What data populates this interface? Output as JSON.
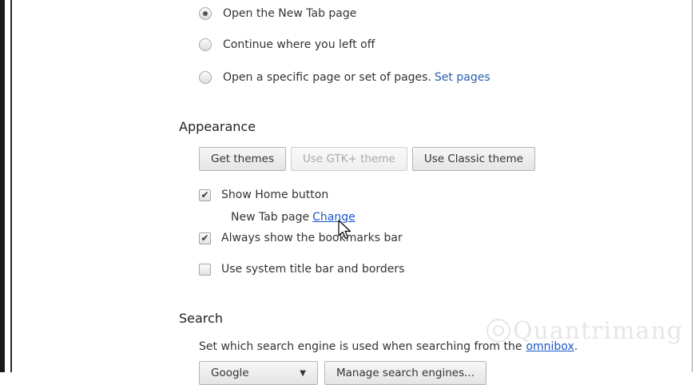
{
  "startup": {
    "options": [
      {
        "label": "Open the New Tab page",
        "checked": true
      },
      {
        "label": "Continue where you left off",
        "checked": false
      },
      {
        "label": "Open a specific page or set of pages.",
        "checked": false
      }
    ],
    "set_pages_link": "Set pages"
  },
  "appearance": {
    "title": "Appearance",
    "buttons": {
      "get_themes": "Get themes",
      "use_gtk_theme": "Use GTK+ theme",
      "use_classic_theme": "Use Classic theme"
    },
    "show_home_button": {
      "label": "Show Home button",
      "checked": true
    },
    "home_page": {
      "label": "New Tab page",
      "change_link": "Change"
    },
    "show_bookmarks_bar": {
      "label": "Always show the bookmarks bar",
      "checked": true
    },
    "system_title_bar": {
      "label": "Use system title bar and borders",
      "checked": false
    }
  },
  "search": {
    "title": "Search",
    "description": "Set which search engine is used when searching from the",
    "omnibox_link": "omnibox",
    "description_end": ".",
    "engine_select": "Google",
    "manage_button": "Manage search engines..."
  },
  "watermark": {
    "text": "Quantrimang"
  },
  "colors": {
    "link": "#2a5db0",
    "text": "#333333"
  }
}
